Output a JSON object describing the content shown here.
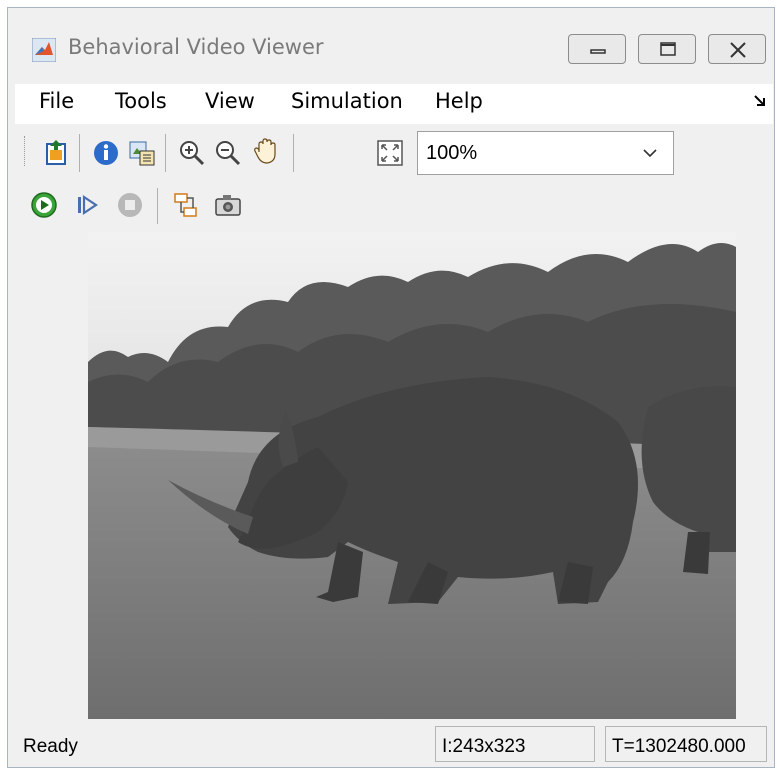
{
  "window": {
    "title": "Behavioral Video Viewer",
    "accent": "#e0552b"
  },
  "menu": {
    "items": [
      "File",
      "Tools",
      "View",
      "Simulation",
      "Help"
    ]
  },
  "toolbar": {
    "icons": [
      "export-icon",
      "info-icon",
      "properties-icon",
      "zoom-in-icon",
      "zoom-out-icon",
      "pan-hand-icon",
      "fit-to-window-icon"
    ],
    "zoom": {
      "value": "100%"
    }
  },
  "playback": {
    "icons": [
      "play-icon",
      "step-forward-icon",
      "stop-icon",
      "highlight-block-icon",
      "snapshot-icon"
    ]
  },
  "frame": {
    "image_description_icon": "rhinoceros-grayscale-frame"
  },
  "status": {
    "state": "Ready",
    "image_size": "I:243x323",
    "time": "T=1302480.000"
  }
}
